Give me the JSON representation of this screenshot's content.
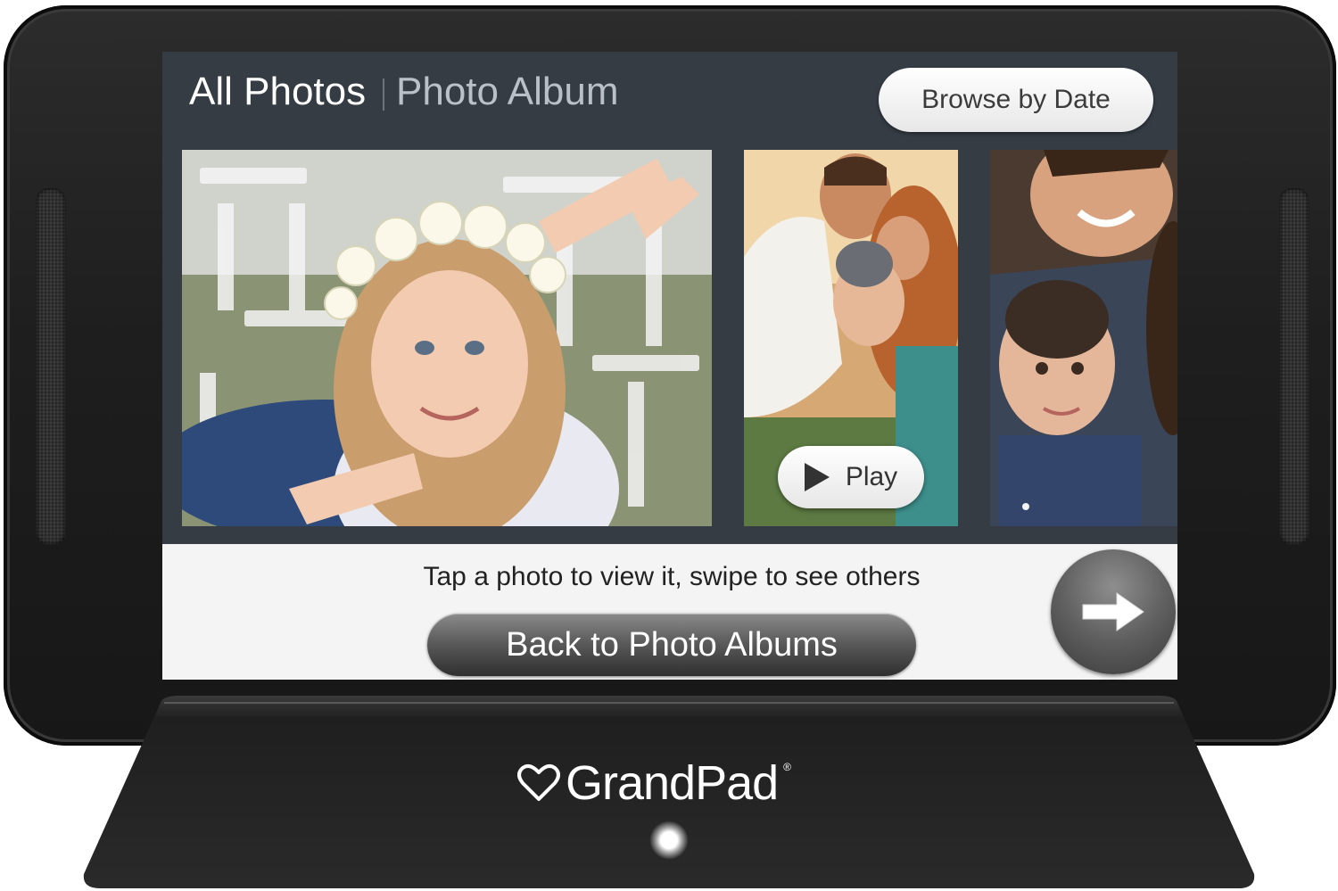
{
  "device": {
    "brand_name": "GrandPad",
    "brand_mark": "®"
  },
  "header": {
    "title": "All Photos",
    "subtitle": "Photo Album",
    "browse_button_label": "Browse by Date"
  },
  "photos": [
    {
      "kind": "photo"
    },
    {
      "kind": "video",
      "play_label": "Play"
    },
    {
      "kind": "photo"
    }
  ],
  "footer": {
    "hint": "Tap a photo to view it, swipe to see others",
    "back_button_label": "Back to Photo Albums",
    "next_icon": "arrow-right-icon"
  },
  "colors": {
    "screen_background": "#353c44",
    "panel_background": "#f4f4f4",
    "device_body": "#1e1e1e"
  }
}
